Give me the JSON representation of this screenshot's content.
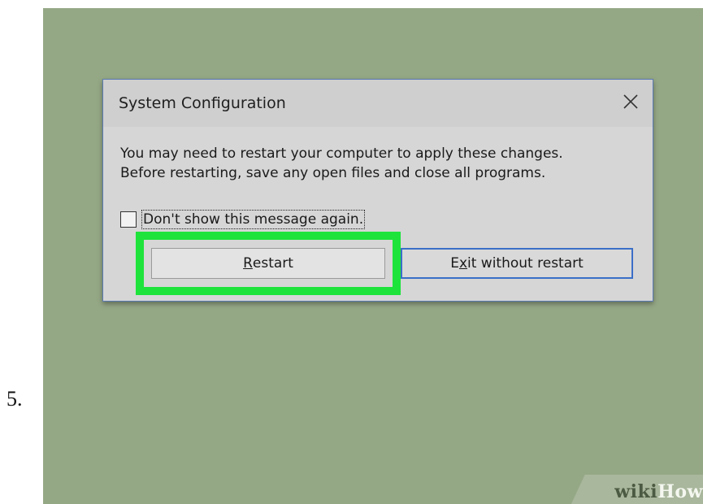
{
  "step": {
    "number": "5."
  },
  "dialog": {
    "title": "System Configuration",
    "message_line1": "You may need to restart your computer to apply these changes.",
    "message_line2": "Before restarting, save any open files and close all programs.",
    "checkbox": {
      "label": "Don't show this message again.",
      "checked": false
    },
    "buttons": {
      "restart": {
        "access_key": "R",
        "rest": "estart"
      },
      "exit": {
        "prefix": "E",
        "access_key": "x",
        "rest": "it without restart"
      }
    },
    "close_icon": "close-icon"
  },
  "highlight": {
    "color": "#1ee33b",
    "target": "restart-button"
  },
  "watermark": {
    "part1": "wiki",
    "part2": "How"
  },
  "colors": {
    "background": "#95a886",
    "dialog": "#d6d6d6",
    "accent_border": "#3b6fc7"
  }
}
